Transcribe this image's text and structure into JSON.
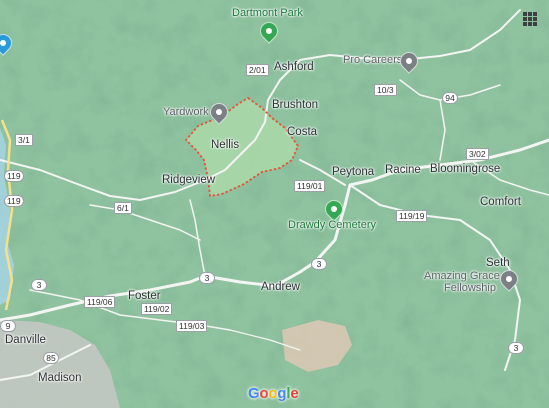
{
  "map": {
    "logo_letters": [
      {
        "ch": "G",
        "color": "#4285F4"
      },
      {
        "ch": "o",
        "color": "#EA4335"
      },
      {
        "ch": "o",
        "color": "#FBBC05"
      },
      {
        "ch": "g",
        "color": "#4285F4"
      },
      {
        "ch": "l",
        "color": "#34A853"
      },
      {
        "ch": "e",
        "color": "#EA4335"
      }
    ],
    "colors": {
      "land": "#8fc29f",
      "park": "#a8d5a6",
      "road": "#f4f6f4",
      "water": "#aadaff",
      "urban": "#c9c6c2",
      "boundary": "#e8543a",
      "park_pin": "#34a853",
      "gray_pin": "#7b8085"
    },
    "places": {
      "ashford": "Ashford",
      "brushton": "Brushton",
      "costa": "Costa",
      "nellis": "Nellis",
      "ridgeview": "Ridgeview",
      "peytona": "Peytona",
      "racine": "Racine",
      "bloomingrose": "Bloomingrose",
      "comfort": "Comfort",
      "seth": "Seth",
      "andrew": "Andrew",
      "foster": "Foster",
      "danville": "Danville",
      "madison": "Madison"
    },
    "pois": {
      "dartmont_park": "Dartmont Park",
      "pro_careers": "Pro Careers",
      "yardwork": "Yardwork",
      "drawdy_cemetery": "Drawdy Cemetery",
      "amazing_grace_line1": "Amazing Grace",
      "amazing_grace_line2": "Fellowship"
    },
    "shields": {
      "r2_01": "2/01",
      "r10_3": "10/3",
      "r94": "94",
      "r3_02": "3/02",
      "r3_1": "3/1",
      "r119_a": "119",
      "r119_b": "119",
      "r6_1": "6/1",
      "r119_01": "119/01",
      "r119_19": "119/19",
      "r3_a": "3",
      "r3_b": "3",
      "r3_c": "3",
      "r3_d": "3",
      "r119_06": "119/06",
      "r119_02": "119/02",
      "r119_03": "119/03",
      "r85": "85",
      "r9": "9"
    },
    "icons": [
      "apps-grid-icon",
      "park-pin-icon",
      "place-pin-icon",
      "blue-pin-icon"
    ]
  }
}
